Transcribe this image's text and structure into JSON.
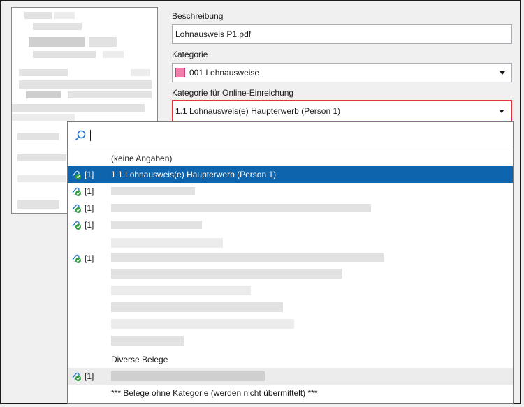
{
  "form": {
    "beschreibung_label": "Beschreibung",
    "beschreibung_value": "Lohnausweis P1.pdf",
    "kategorie_label": "Kategorie",
    "kategorie_value": "001 Lohnausweise",
    "kategorie_color": "#f27cac",
    "online_label": "Kategorie für Online-Einreichung",
    "online_value": "1.1 Lohnausweis(e) Haupterwerb (Person 1)",
    "highlight_color": "#e2333f"
  },
  "dropdown": {
    "search_value": "",
    "none_option": "(keine Angaben)",
    "selected": {
      "count": "[1]",
      "label": "1.1 Lohnausweis(e) Haupterwerb (Person 1)",
      "icon": "attachment-check-icon"
    },
    "blurred_rows": [
      {
        "count": "[1]",
        "icon": "attachment-check-icon"
      },
      {
        "count": "[1]",
        "icon": "attachment-check-icon"
      },
      {
        "count": "[1]",
        "icon": "attachment-check-icon"
      },
      {
        "count": "[1]",
        "icon": "attachment-check-icon"
      }
    ],
    "group_diverse": "Diverse Belege",
    "diverse_row": {
      "count": "[1]",
      "icon": "attachment-check-icon"
    },
    "footer_option": "*** Belege ohne Kategorie (werden nicht übermittelt) ***",
    "selection_color": "#0e64ad"
  }
}
